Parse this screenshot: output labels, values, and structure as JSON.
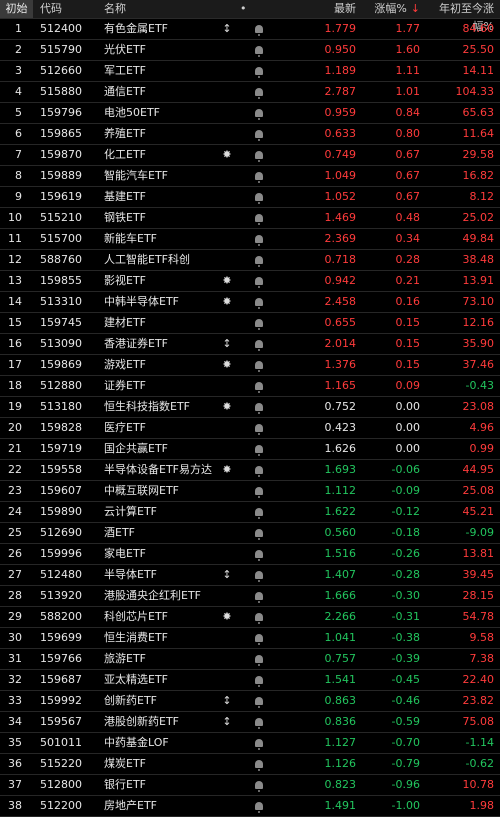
{
  "header": {
    "corner": "初始",
    "code": "代码",
    "name": "名称",
    "dot": "•",
    "price": "最新",
    "pct": "涨幅%",
    "sort_arrow": "↓",
    "ytd": "年初至今涨幅%"
  },
  "colors": {
    "up": "#ff3b3b",
    "down": "#22c55e",
    "flat": "#e6e6e6"
  },
  "rows": [
    {
      "idx": "1",
      "code": "512400",
      "name": "有色金属ETF",
      "flag": "↕",
      "price": "1.779",
      "pct": "1.77",
      "ytd": "84.60",
      "pc": "up",
      "pp": "up",
      "yc": "up"
    },
    {
      "idx": "2",
      "code": "515790",
      "name": "光伏ETF",
      "flag": "",
      "price": "0.950",
      "pct": "1.60",
      "ytd": "25.50",
      "pc": "up",
      "pp": "up",
      "yc": "up"
    },
    {
      "idx": "3",
      "code": "512660",
      "name": "军工ETF",
      "flag": "",
      "price": "1.189",
      "pct": "1.11",
      "ytd": "14.11",
      "pc": "up",
      "pp": "up",
      "yc": "up"
    },
    {
      "idx": "4",
      "code": "515880",
      "name": "通信ETF",
      "flag": "",
      "price": "2.787",
      "pct": "1.01",
      "ytd": "104.33",
      "pc": "up",
      "pp": "up",
      "yc": "up"
    },
    {
      "idx": "5",
      "code": "159796",
      "name": "电池50ETF",
      "flag": "",
      "price": "0.959",
      "pct": "0.84",
      "ytd": "65.63",
      "pc": "up",
      "pp": "up",
      "yc": "up"
    },
    {
      "idx": "6",
      "code": "159865",
      "name": "养殖ETF",
      "flag": "",
      "price": "0.633",
      "pct": "0.80",
      "ytd": "11.64",
      "pc": "up",
      "pp": "up",
      "yc": "up"
    },
    {
      "idx": "7",
      "code": "159870",
      "name": "化工ETF",
      "flag": "✸",
      "price": "0.749",
      "pct": "0.67",
      "ytd": "29.58",
      "pc": "up",
      "pp": "up",
      "yc": "up"
    },
    {
      "idx": "8",
      "code": "159889",
      "name": "智能汽车ETF",
      "flag": "",
      "price": "1.049",
      "pct": "0.67",
      "ytd": "16.82",
      "pc": "up",
      "pp": "up",
      "yc": "up"
    },
    {
      "idx": "9",
      "code": "159619",
      "name": "基建ETF",
      "flag": "",
      "price": "1.052",
      "pct": "0.67",
      "ytd": "8.12",
      "pc": "up",
      "pp": "up",
      "yc": "up"
    },
    {
      "idx": "10",
      "code": "515210",
      "name": "钢铁ETF",
      "flag": "",
      "price": "1.469",
      "pct": "0.48",
      "ytd": "25.02",
      "pc": "up",
      "pp": "up",
      "yc": "up"
    },
    {
      "idx": "11",
      "code": "515700",
      "name": "新能车ETF",
      "flag": "",
      "price": "2.369",
      "pct": "0.34",
      "ytd": "49.84",
      "pc": "up",
      "pp": "up",
      "yc": "up"
    },
    {
      "idx": "12",
      "code": "588760",
      "name": "人工智能ETF科创",
      "flag": "",
      "price": "0.718",
      "pct": "0.28",
      "ytd": "38.48",
      "pc": "up",
      "pp": "up",
      "yc": "up"
    },
    {
      "idx": "13",
      "code": "159855",
      "name": "影视ETF",
      "flag": "✸",
      "price": "0.942",
      "pct": "0.21",
      "ytd": "13.91",
      "pc": "up",
      "pp": "up",
      "yc": "up"
    },
    {
      "idx": "14",
      "code": "513310",
      "name": "中韩半导体ETF",
      "flag": "✸",
      "price": "2.458",
      "pct": "0.16",
      "ytd": "73.10",
      "pc": "up",
      "pp": "up",
      "yc": "up"
    },
    {
      "idx": "15",
      "code": "159745",
      "name": "建材ETF",
      "flag": "",
      "price": "0.655",
      "pct": "0.15",
      "ytd": "12.16",
      "pc": "up",
      "pp": "up",
      "yc": "up"
    },
    {
      "idx": "16",
      "code": "513090",
      "name": "香港证券ETF",
      "flag": "↕",
      "price": "2.014",
      "pct": "0.15",
      "ytd": "35.90",
      "pc": "up",
      "pp": "up",
      "yc": "up"
    },
    {
      "idx": "17",
      "code": "159869",
      "name": "游戏ETF",
      "flag": "✸",
      "price": "1.376",
      "pct": "0.15",
      "ytd": "37.46",
      "pc": "up",
      "pp": "up",
      "yc": "up"
    },
    {
      "idx": "18",
      "code": "512880",
      "name": "证券ETF",
      "flag": "",
      "price": "1.165",
      "pct": "0.09",
      "ytd": "-0.43",
      "pc": "up",
      "pp": "up",
      "yc": "down"
    },
    {
      "idx": "19",
      "code": "513180",
      "name": "恒生科技指数ETF",
      "flag": "✸",
      "price": "0.752",
      "pct": "0.00",
      "ytd": "23.08",
      "pc": "flat",
      "pp": "flat",
      "yc": "up"
    },
    {
      "idx": "20",
      "code": "159828",
      "name": "医疗ETF",
      "flag": "",
      "price": "0.423",
      "pct": "0.00",
      "ytd": "4.96",
      "pc": "flat",
      "pp": "flat",
      "yc": "up"
    },
    {
      "idx": "21",
      "code": "159719",
      "name": "国企共赢ETF",
      "flag": "",
      "price": "1.626",
      "pct": "0.00",
      "ytd": "0.99",
      "pc": "flat",
      "pp": "flat",
      "yc": "up"
    },
    {
      "idx": "22",
      "code": "159558",
      "name": "半导体设备ETF易方达",
      "flag": "✸",
      "price": "1.693",
      "pct": "-0.06",
      "ytd": "44.95",
      "pc": "down",
      "pp": "down",
      "yc": "up"
    },
    {
      "idx": "23",
      "code": "159607",
      "name": "中概互联网ETF",
      "flag": "",
      "price": "1.112",
      "pct": "-0.09",
      "ytd": "25.08",
      "pc": "down",
      "pp": "down",
      "yc": "up"
    },
    {
      "idx": "24",
      "code": "159890",
      "name": "云计算ETF",
      "flag": "",
      "price": "1.622",
      "pct": "-0.12",
      "ytd": "45.21",
      "pc": "down",
      "pp": "down",
      "yc": "up"
    },
    {
      "idx": "25",
      "code": "512690",
      "name": "酒ETF",
      "flag": "",
      "price": "0.560",
      "pct": "-0.18",
      "ytd": "-9.09",
      "pc": "down",
      "pp": "down",
      "yc": "down"
    },
    {
      "idx": "26",
      "code": "159996",
      "name": "家电ETF",
      "flag": "",
      "price": "1.516",
      "pct": "-0.26",
      "ytd": "13.81",
      "pc": "down",
      "pp": "down",
      "yc": "up"
    },
    {
      "idx": "27",
      "code": "512480",
      "name": "半导体ETF",
      "flag": "↕",
      "price": "1.407",
      "pct": "-0.28",
      "ytd": "39.45",
      "pc": "down",
      "pp": "down",
      "yc": "up"
    },
    {
      "idx": "28",
      "code": "513920",
      "name": "港股通央企红利ETF",
      "flag": "",
      "price": "1.666",
      "pct": "-0.30",
      "ytd": "28.15",
      "pc": "down",
      "pp": "down",
      "yc": "up"
    },
    {
      "idx": "29",
      "code": "588200",
      "name": "科创芯片ETF",
      "flag": "✸",
      "price": "2.266",
      "pct": "-0.31",
      "ytd": "54.78",
      "pc": "down",
      "pp": "down",
      "yc": "up"
    },
    {
      "idx": "30",
      "code": "159699",
      "name": "恒生消费ETF",
      "flag": "",
      "price": "1.041",
      "pct": "-0.38",
      "ytd": "9.58",
      "pc": "down",
      "pp": "down",
      "yc": "up"
    },
    {
      "idx": "31",
      "code": "159766",
      "name": "旅游ETF",
      "flag": "",
      "price": "0.757",
      "pct": "-0.39",
      "ytd": "7.38",
      "pc": "down",
      "pp": "down",
      "yc": "up"
    },
    {
      "idx": "32",
      "code": "159687",
      "name": "亚太精选ETF",
      "flag": "",
      "price": "1.541",
      "pct": "-0.45",
      "ytd": "22.40",
      "pc": "down",
      "pp": "down",
      "yc": "up"
    },
    {
      "idx": "33",
      "code": "159992",
      "name": "创新药ETF",
      "flag": "↕",
      "price": "0.863",
      "pct": "-0.46",
      "ytd": "23.82",
      "pc": "down",
      "pp": "down",
      "yc": "up"
    },
    {
      "idx": "34",
      "code": "159567",
      "name": "港股创新药ETF",
      "flag": "↕",
      "price": "0.836",
      "pct": "-0.59",
      "ytd": "75.08",
      "pc": "down",
      "pp": "down",
      "yc": "up"
    },
    {
      "idx": "35",
      "code": "501011",
      "name": "中药基金LOF",
      "flag": "",
      "price": "1.127",
      "pct": "-0.70",
      "ytd": "-1.14",
      "pc": "down",
      "pp": "down",
      "yc": "down"
    },
    {
      "idx": "36",
      "code": "515220",
      "name": "煤炭ETF",
      "flag": "",
      "price": "1.126",
      "pct": "-0.79",
      "ytd": "-0.62",
      "pc": "down",
      "pp": "down",
      "yc": "down"
    },
    {
      "idx": "37",
      "code": "512800",
      "name": "银行ETF",
      "flag": "",
      "price": "0.823",
      "pct": "-0.96",
      "ytd": "10.78",
      "pc": "down",
      "pp": "down",
      "yc": "up"
    },
    {
      "idx": "38",
      "code": "512200",
      "name": "房地产ETF",
      "flag": "",
      "price": "1.491",
      "pct": "-1.00",
      "ytd": "1.98",
      "pc": "down",
      "pp": "down",
      "yc": "up"
    }
  ]
}
